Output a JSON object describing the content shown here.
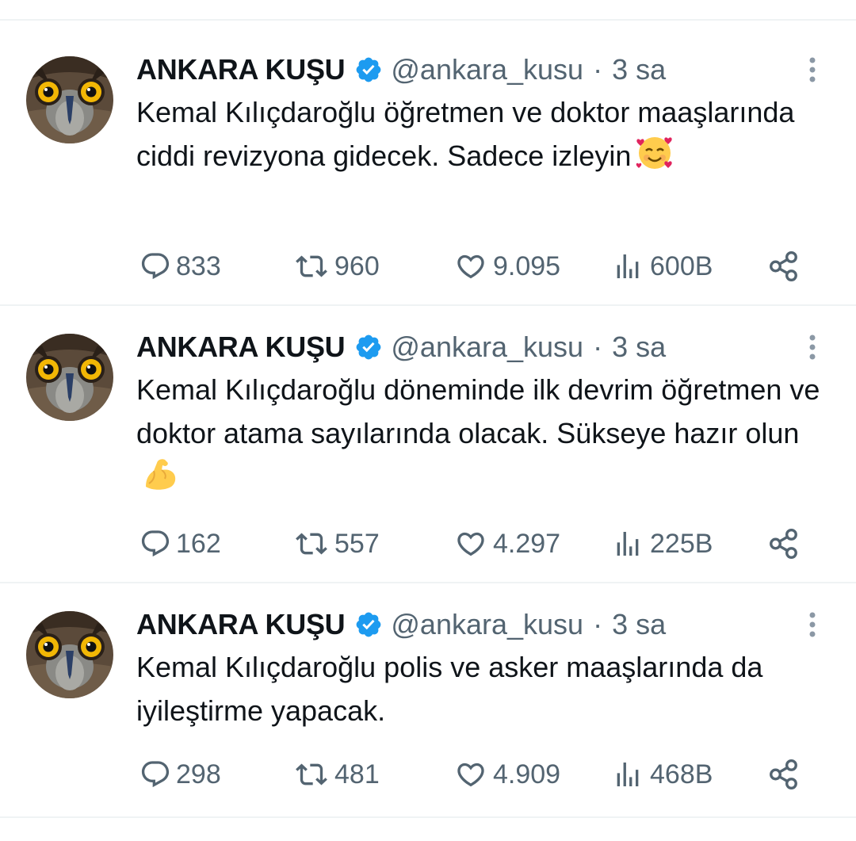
{
  "tweets": [
    {
      "author_name": "ANKARA KUŞU",
      "handle": "@ankara_kusu",
      "separator": "·",
      "time": "3 sa",
      "text": "Kemal Kılıçdaroğlu öğretmen ve doktor maaşlarında ciddi revizyona gidecek. Sadece izleyin",
      "emoji": "smiling-face-with-hearts",
      "stats": {
        "replies": "833",
        "retweets": "960",
        "likes": "9.095",
        "views": "600B"
      }
    },
    {
      "author_name": "ANKARA KUŞU",
      "handle": "@ankara_kusu",
      "separator": "·",
      "time": "3 sa",
      "text": "Kemal Kılıçdaroğlu döneminde ilk devrim öğretmen ve doktor atama sayılarında olacak. Sükseye hazır olun",
      "emoji": "flexed-biceps",
      "stats": {
        "replies": "162",
        "retweets": "557",
        "likes": "4.297",
        "views": "225B"
      }
    },
    {
      "author_name": "ANKARA KUŞU",
      "handle": "@ankara_kusu",
      "separator": "·",
      "time": "3 sa",
      "text": "Kemal Kılıçdaroğlu polis ve asker maaşlarında da iyileştirme yapacak.",
      "emoji": "",
      "stats": {
        "replies": "298",
        "retweets": "481",
        "likes": "4.909",
        "views": "468B"
      }
    }
  ],
  "colors": {
    "text_primary": "#0f1419",
    "text_secondary": "#536471",
    "verified_blue": "#1d9bf0",
    "divider": "#eff3f4"
  }
}
